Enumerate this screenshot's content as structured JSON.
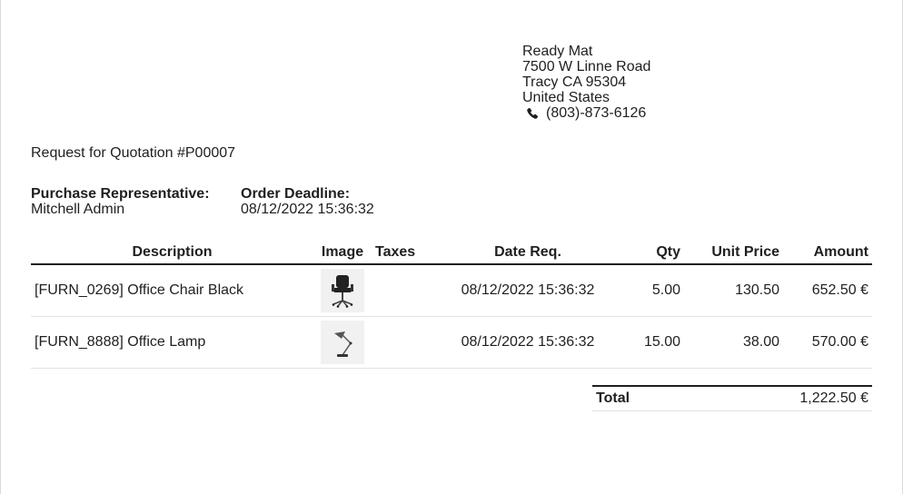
{
  "vendor": {
    "name": "Ready Mat",
    "street": "7500 W Linne Road",
    "city_line": "Tracy CA 95304",
    "country": "United States",
    "phone": "(803)-873-6126",
    "phone_icon": "phone-icon"
  },
  "document": {
    "title": "Request for Quotation #P00007"
  },
  "info": {
    "representative_label": "Purchase Representative:",
    "representative_value": "Mitchell Admin",
    "deadline_label": "Order Deadline:",
    "deadline_value": "08/12/2022 15:36:32"
  },
  "table": {
    "headers": {
      "description": "Description",
      "image": "Image",
      "taxes": "Taxes",
      "date_req": "Date Req.",
      "qty": "Qty",
      "unit_price": "Unit Price",
      "amount": "Amount"
    },
    "rows": [
      {
        "description": "[FURN_0269] Office Chair Black",
        "image": "office-chair-image",
        "taxes": "",
        "date_req": "08/12/2022 15:36:32",
        "qty": "5.00",
        "unit_price": "130.50",
        "amount": "652.50 €"
      },
      {
        "description": "[FURN_8888] Office Lamp",
        "image": "office-lamp-image",
        "taxes": "",
        "date_req": "08/12/2022 15:36:32",
        "qty": "15.00",
        "unit_price": "38.00",
        "amount": "570.00 €"
      }
    ]
  },
  "totals": {
    "label": "Total",
    "value": "1,222.50 €"
  }
}
